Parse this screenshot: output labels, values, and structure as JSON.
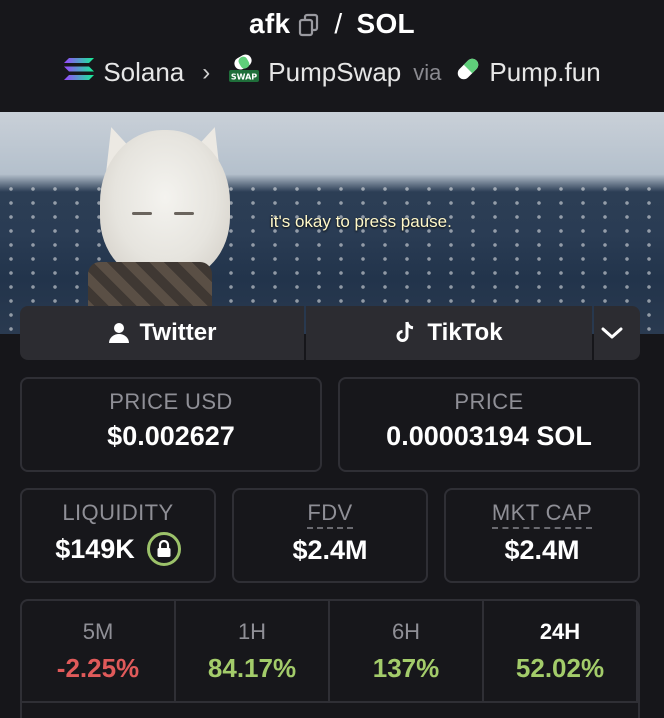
{
  "header": {
    "token": "afk",
    "separator": "/",
    "quote": "SOL",
    "chain": "Solana",
    "dex": "PumpSwap",
    "dex_icon_text": "SWAP",
    "via": "via",
    "launchpad": "Pump.fun"
  },
  "banner": {
    "caption": "it's okay to press pause."
  },
  "social": {
    "twitter": "Twitter",
    "tiktok": "TikTok"
  },
  "stats": {
    "price_usd_label": "PRICE USD",
    "price_usd": "$0.002627",
    "price_label": "PRICE",
    "price": "0.00003194 SOL",
    "liquidity_label": "LIQUIDITY",
    "liquidity": "$149K",
    "fdv_label": "FDV",
    "fdv": "$2.4M",
    "mktcap_label": "MKT CAP",
    "mktcap": "$2.4M"
  },
  "changes": [
    {
      "label": "5M",
      "value": "-2.25%",
      "color": "#e05a5a"
    },
    {
      "label": "1H",
      "value": "84.17%",
      "color": "#a3cc6a"
    },
    {
      "label": "6H",
      "value": "137%",
      "color": "#a3cc6a"
    },
    {
      "label": "24H",
      "value": "52.02%",
      "color": "#a3cc6a"
    }
  ],
  "icons": {
    "copy": "copy-icon",
    "solana": "solana-icon",
    "pumpswap": "pumpswap-icon",
    "pumpfun": "pill-icon",
    "user": "user-icon",
    "tiktok": "tiktok-icon",
    "chevron": "chevron-down-icon",
    "lock": "lock-icon"
  },
  "colors": {
    "positive": "#a3cc6a",
    "negative": "#e05a5a",
    "accent_lock": "#9cc26a"
  }
}
